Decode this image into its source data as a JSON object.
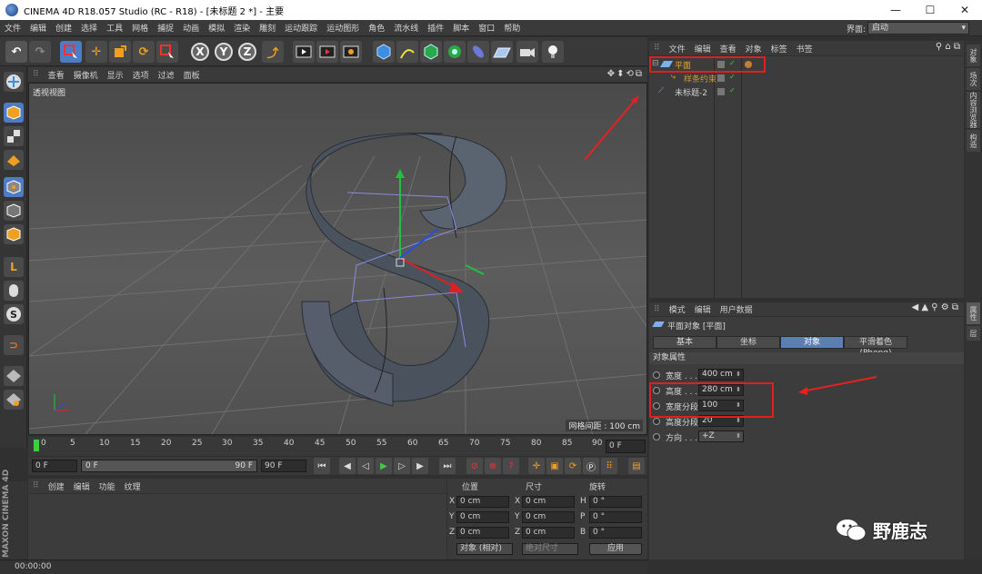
{
  "window": {
    "title": "CINEMA 4D R18.057 Studio (RC - R18) - [未标题 2 *] - 主要",
    "minimize": "—",
    "maximize": "☐",
    "close": "✕"
  },
  "menubar": {
    "items": [
      "文件",
      "编辑",
      "创建",
      "选择",
      "工具",
      "网格",
      "捕捉",
      "动画",
      "模拟",
      "渲染",
      "雕刻",
      "运动跟踪",
      "运动图形",
      "角色",
      "流水线",
      "插件",
      "脚本",
      "窗口",
      "帮助"
    ],
    "layout_label": "界面:",
    "layout_value": "启动"
  },
  "toolbar": {
    "x_label": "X",
    "y_label": "Y",
    "z_label": "Z"
  },
  "viewport": {
    "menu": [
      "查看",
      "摄像机",
      "显示",
      "选项",
      "过滤",
      "面板"
    ],
    "nav_icons": "✥⬍⟲⧉",
    "label": "透视视图",
    "grid_spacing": "网格间距 : 100 cm"
  },
  "timeline": {
    "ticks": [
      "0",
      "5",
      "10",
      "15",
      "20",
      "25",
      "30",
      "35",
      "40",
      "45",
      "50",
      "55",
      "60",
      "65",
      "70",
      "75",
      "80",
      "85",
      "90"
    ],
    "end_frame": "0 F",
    "current_frame": "0 F",
    "range_start": "0 F",
    "range_end": "90 F",
    "max_frame": "90 F"
  },
  "material": {
    "menu": [
      "创建",
      "编辑",
      "功能",
      "纹理"
    ],
    "maxon": "MAXON CINEMA 4D"
  },
  "coord": {
    "headers": [
      "位置",
      "尺寸",
      "旋转"
    ],
    "rows": [
      {
        "axis1": "X",
        "pos": "0 cm",
        "axis2": "X",
        "size": "0 cm",
        "axis3": "H",
        "rot": "0 °"
      },
      {
        "axis1": "Y",
        "pos": "0 cm",
        "axis2": "Y",
        "size": "0 cm",
        "axis3": "P",
        "rot": "0 °"
      },
      {
        "axis1": "Z",
        "pos": "0 cm",
        "axis2": "Z",
        "size": "0 cm",
        "axis3": "B",
        "rot": "0 °"
      }
    ],
    "mode": "对象 (相对)",
    "size_mode": "绝对尺寸",
    "apply": "应用"
  },
  "status": {
    "time": "00:00:00"
  },
  "object_manager": {
    "menu": [
      "文件",
      "编辑",
      "查看",
      "对象",
      "标签",
      "书签"
    ],
    "tools": "⚲ ⌂ ⧉",
    "objects": [
      {
        "name": "平面",
        "color": "#f0a830"
      },
      {
        "name": "样条约束",
        "color": "#c89a40"
      },
      {
        "name": "未标题-2",
        "color": "#d0d0d0"
      }
    ]
  },
  "side_tabs": [
    "对象",
    "场次",
    "内容浏览器",
    "构造",
    "属性",
    "层"
  ],
  "attribute_manager": {
    "menu": [
      "模式",
      "编辑",
      "用户数据"
    ],
    "title": "平面对象 [平面]",
    "tabs": [
      "基本",
      "坐标",
      "对象",
      "平滑着色(Phong)"
    ],
    "section": "对象属性",
    "props": [
      {
        "label": "宽度 . . .",
        "value": "400 cm"
      },
      {
        "label": "高度 . . .",
        "value": "280 cm"
      },
      {
        "label": "宽度分段",
        "value": "100"
      },
      {
        "label": "高度分段",
        "value": "20"
      },
      {
        "label": "方向 . . .",
        "value": "+Z"
      }
    ]
  },
  "watermark": {
    "text": "野鹿志"
  }
}
